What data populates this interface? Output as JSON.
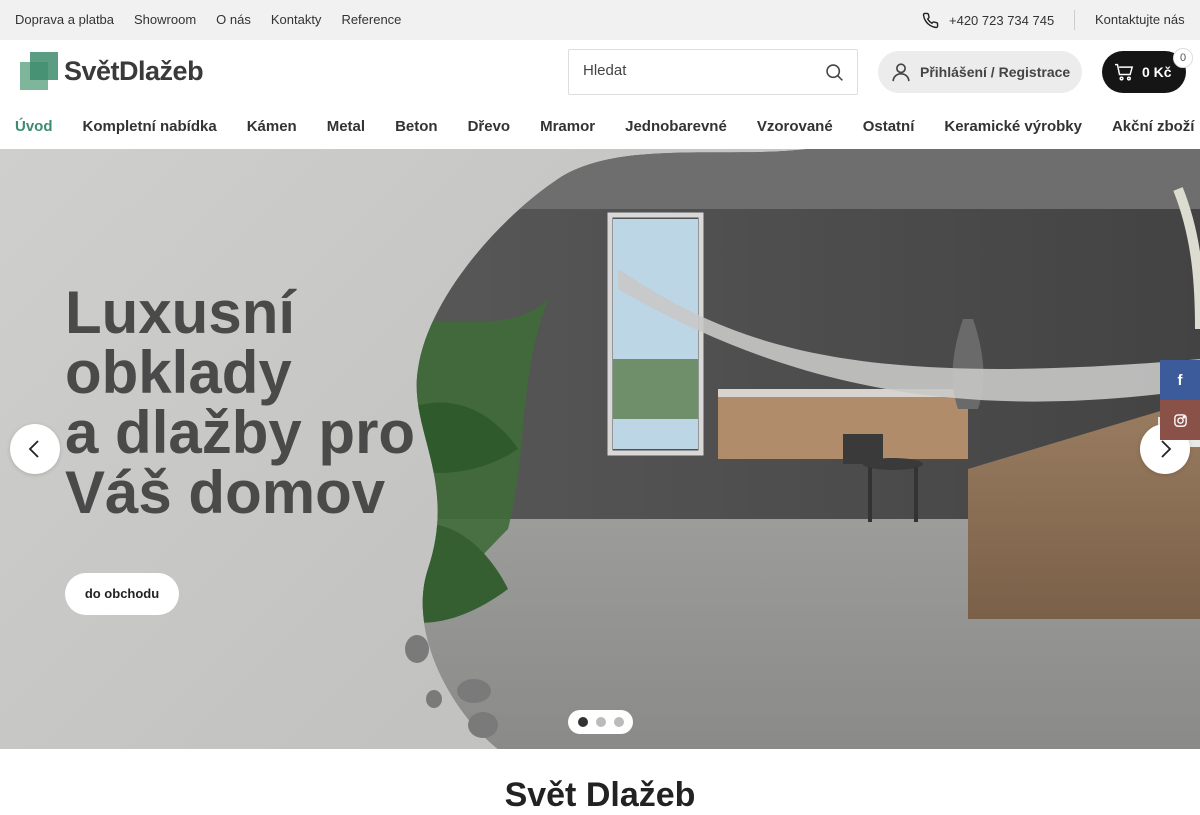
{
  "topbar": {
    "links": [
      "Doprava a platba",
      "Showroom",
      "O nás",
      "Kontakty",
      "Reference"
    ],
    "phone": "+420 723 734 745",
    "contact_label": "Kontaktujte nás"
  },
  "header": {
    "logo_text": "SvětDlažeb",
    "search_placeholder": "Hledat",
    "login_label": "Přihlášení / Registrace",
    "cart_total": "0 Kč",
    "cart_count": "0"
  },
  "nav": {
    "items": [
      "Úvod",
      "Kompletní nabídka",
      "Kámen",
      "Metal",
      "Beton",
      "Dřevo",
      "Mramor",
      "Jednobarevné",
      "Vzorované",
      "Ostatní",
      "Keramické výrobky",
      "Akční zboží"
    ],
    "active_index": 0
  },
  "hero": {
    "headline_lines": [
      "Luxusní",
      "obklady",
      "a dlažby pro",
      "Váš domov"
    ],
    "button_label": "do obchodu",
    "slides_total": 3,
    "active_slide": 1
  },
  "social": {
    "facebook_glyph": "f",
    "icons": [
      "facebook-icon",
      "instagram-icon"
    ]
  },
  "section": {
    "title": "Svět Dlažeb"
  },
  "colors": {
    "brand_green": "#3d8c6d",
    "cart_bg": "#151515",
    "facebook": "#3b5b9a",
    "instagram": "#8a5149"
  }
}
